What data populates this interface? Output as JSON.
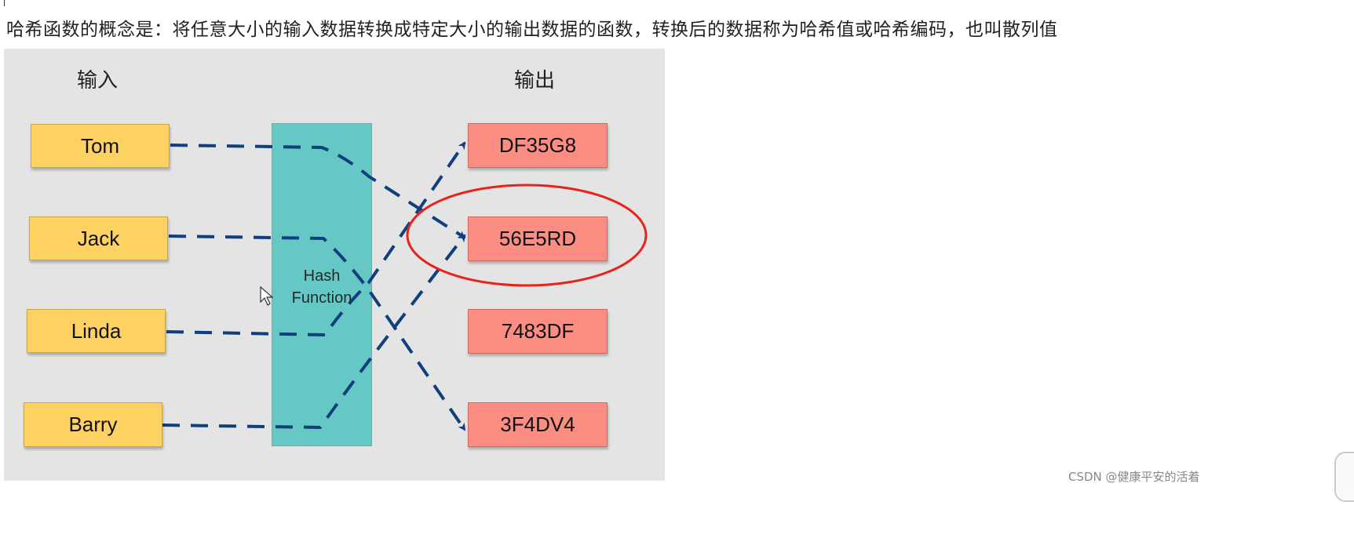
{
  "intro_text": "哈希函数的概念是：将任意大小的输入数据转换成特定大小的输出数据的函数，转换后的数据称为哈希值或哈希编码，也叫散列值",
  "diagram": {
    "input_header": "输入",
    "output_header": "输出",
    "inputs": [
      "Tom",
      "Jack",
      "Linda",
      "Barry"
    ],
    "hash_function_label": [
      "Hash",
      "Function"
    ],
    "outputs": [
      "DF35G8",
      "56E5RD",
      "7483DF",
      "3F4DV4"
    ],
    "mappings": [
      {
        "from": "Tom",
        "to": "56E5RD"
      },
      {
        "from": "Jack",
        "to": "3F4DV4"
      },
      {
        "from": "Linda",
        "to": "DF35G8"
      },
      {
        "from": "Barry",
        "to": "56E5RD"
      }
    ],
    "highlighted_output": "56E5RD",
    "colors": {
      "panel_bg": "#e4e4e4",
      "input_box": "#fdd262",
      "output_box": "#fc8d82",
      "hash_box": "#66c8c5",
      "link": "#0f3f7c",
      "highlight": "#e8231b"
    }
  },
  "watermark": "CSDN @健康平安的活着"
}
